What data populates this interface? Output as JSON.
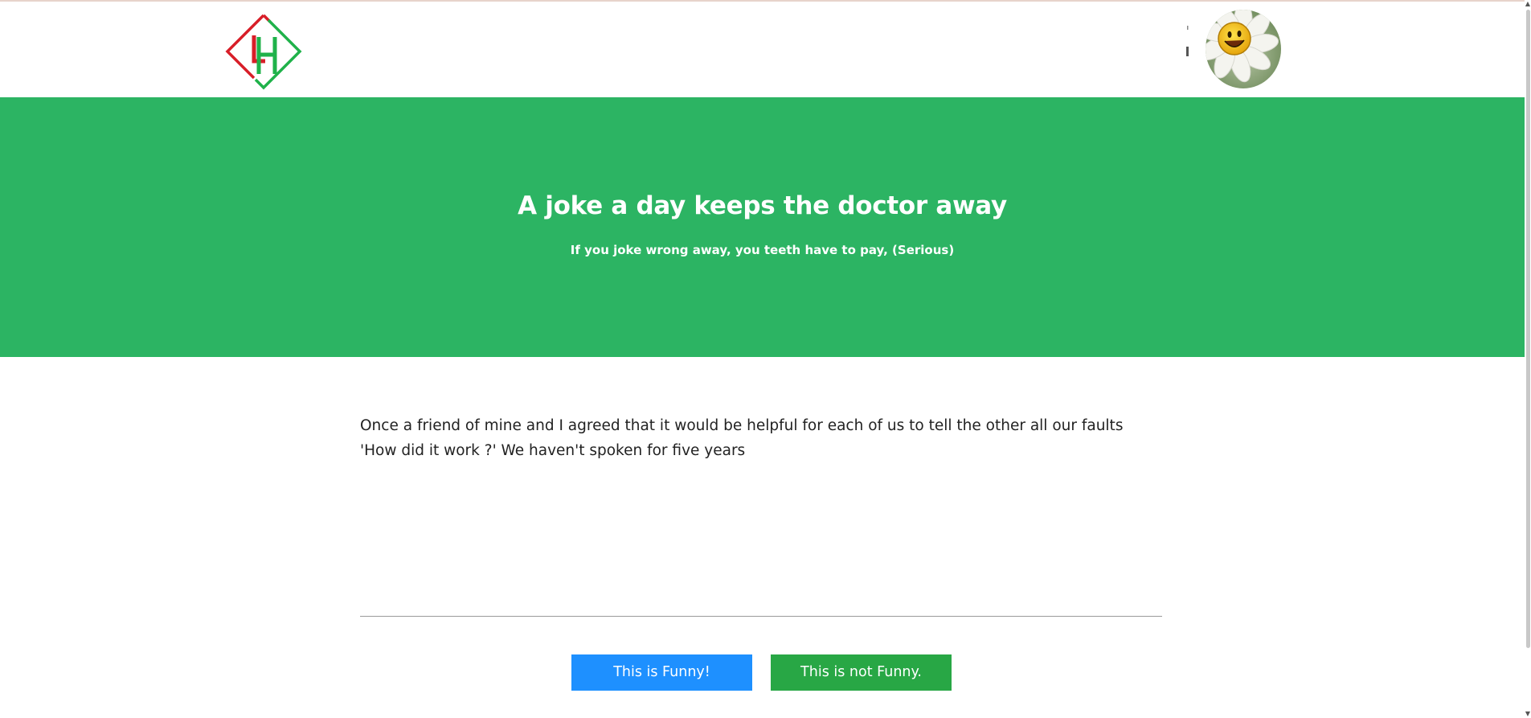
{
  "header": {
    "logo_icon": "lh-diamond-logo",
    "avatar_icon": "smiling-daisy-avatar"
  },
  "hero": {
    "title": "A joke a day keeps the doctor away",
    "subtitle": "If you joke wrong away, you teeth have to pay, (Serious)",
    "background_color": "#2cb463"
  },
  "joke": {
    "text": "Once a friend of mine and I agreed that it would be helpful for each of us to tell the other all our faults 'How did it work ?' We haven't spoken for five years"
  },
  "actions": {
    "funny_label": "This is Funny!",
    "not_funny_label": "This is not Funny.",
    "funny_color": "#1e90ff",
    "not_funny_color": "#28a745"
  }
}
